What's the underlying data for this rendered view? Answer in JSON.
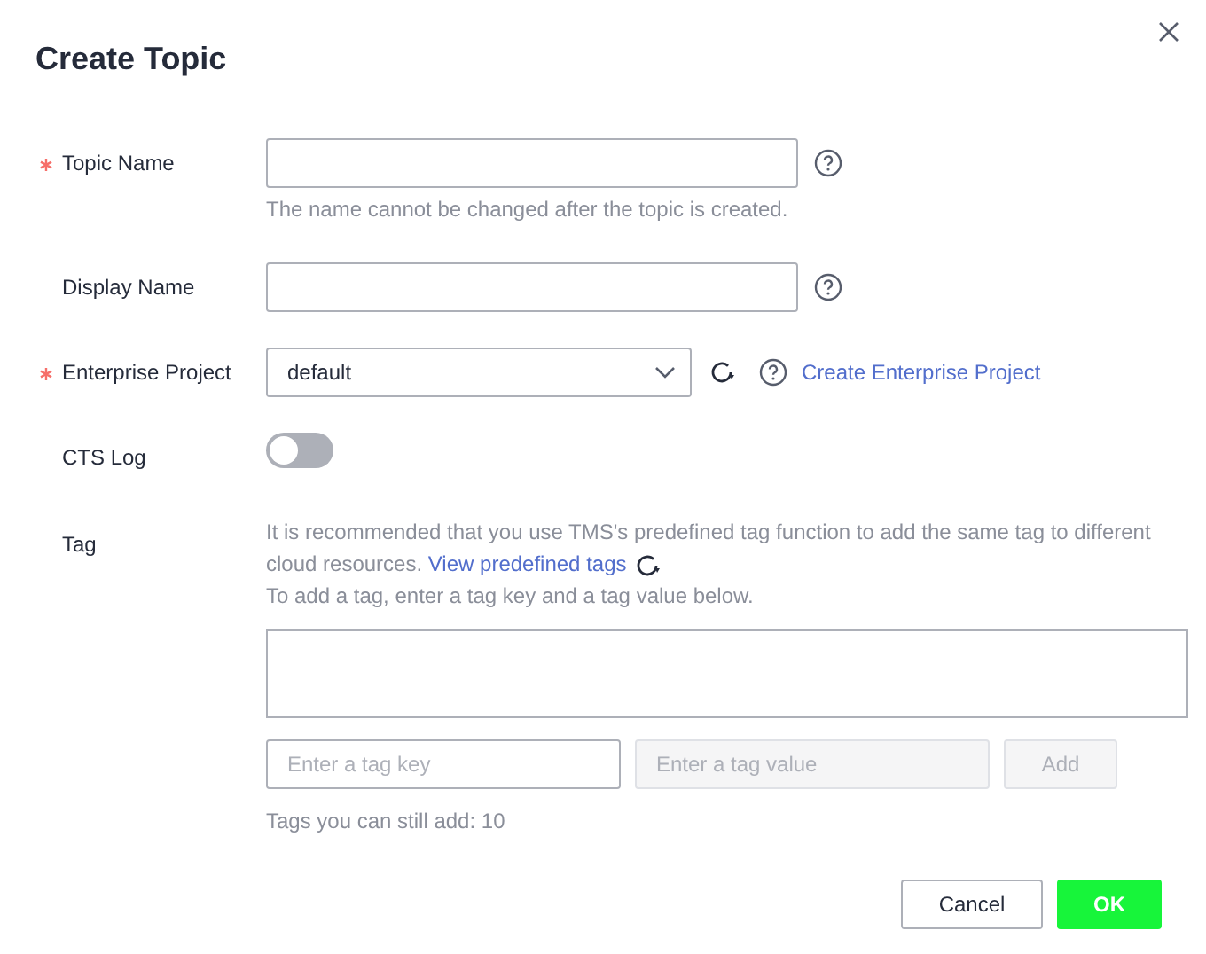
{
  "dialog": {
    "title": "Create Topic"
  },
  "fields": [
    {
      "kind": "text",
      "label": "Topic Name",
      "required": true,
      "hint": "The name cannot be changed after the topic is created."
    },
    {
      "kind": "text",
      "label": "Display Name",
      "required": false
    },
    {
      "kind": "select",
      "label": "Enterprise Project",
      "required": true,
      "value": "default",
      "link": "Create Enterprise Project"
    },
    {
      "kind": "switch",
      "label": "CTS Log",
      "required": false,
      "on": false
    },
    {
      "kind": "tags",
      "label": "Tag",
      "required": false,
      "notice": "It is recommended that you use TMS's predefined tag function to add the same tag to different cloud resources.",
      "notice_link": "View predefined tags",
      "instruction": "To add a tag, enter a tag key and a tag value below.",
      "key_placeholder": "Enter a tag key",
      "value_placeholder": "Enter a tag value",
      "value_disabled": true,
      "add_label": "Add",
      "add_disabled": true,
      "remaining": "Tags you can still add: 10"
    }
  ],
  "buttons": [
    {
      "label": "Cancel",
      "kind": "secondary"
    },
    {
      "label": "OK",
      "kind": "primary"
    }
  ]
}
